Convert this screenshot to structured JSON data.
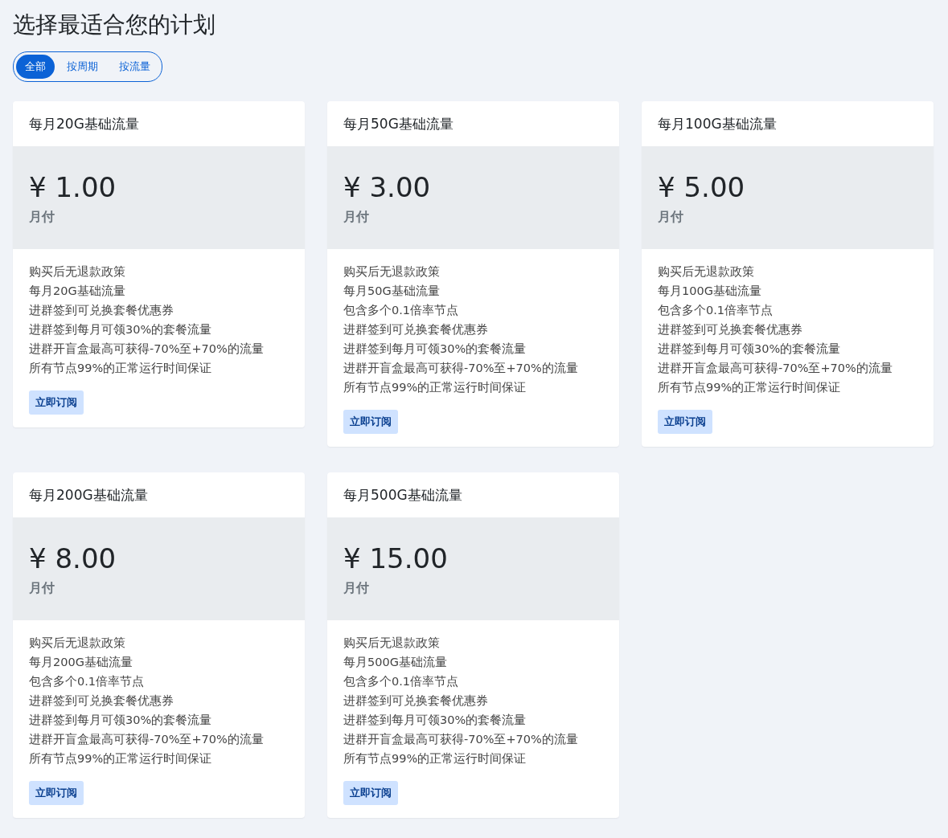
{
  "title": "选择最适合您的计划",
  "tabs": [
    {
      "label": "全部",
      "selected": true
    },
    {
      "label": "按周期",
      "selected": false
    },
    {
      "label": "按流量",
      "selected": false
    }
  ],
  "plans": [
    {
      "name": "每月20G基础流量",
      "price": "¥ 1.00",
      "period": "月付",
      "features": [
        "购买后无退款政策",
        "每月20G基础流量",
        "进群签到可兑换套餐优惠券",
        "进群签到每月可领30%的套餐流量",
        "进群开盲盒最高可获得-70%至+70%的流量",
        "所有节点99%的正常运行时间保证"
      ],
      "button": "立即订阅"
    },
    {
      "name": "每月50G基础流量",
      "price": "¥ 3.00",
      "period": "月付",
      "features": [
        "购买后无退款政策",
        "每月50G基础流量",
        "包含多个0.1倍率节点",
        "进群签到可兑换套餐优惠券",
        "进群签到每月可领30%的套餐流量",
        "进群开盲盒最高可获得-70%至+70%的流量",
        "所有节点99%的正常运行时间保证"
      ],
      "button": "立即订阅"
    },
    {
      "name": "每月100G基础流量",
      "price": "¥ 5.00",
      "period": "月付",
      "features": [
        "购买后无退款政策",
        "每月100G基础流量",
        "包含多个0.1倍率节点",
        "进群签到可兑换套餐优惠券",
        "进群签到每月可领30%的套餐流量",
        "进群开盲盒最高可获得-70%至+70%的流量",
        "所有节点99%的正常运行时间保证"
      ],
      "button": "立即订阅"
    },
    {
      "name": "每月200G基础流量",
      "price": "¥ 8.00",
      "period": "月付",
      "features": [
        "购买后无退款政策",
        "每月200G基础流量",
        "包含多个0.1倍率节点",
        "进群签到可兑换套餐优惠券",
        "进群签到每月可领30%的套餐流量",
        "进群开盲盒最高可获得-70%至+70%的流量",
        "所有节点99%的正常运行时间保证"
      ],
      "button": "立即订阅"
    },
    {
      "name": "每月500G基础流量",
      "price": "¥ 15.00",
      "period": "月付",
      "features": [
        "购买后无退款政策",
        "每月500G基础流量",
        "包含多个0.1倍率节点",
        "进群签到可兑换套餐优惠券",
        "进群签到每月可领30%的套餐流量",
        "进群开盲盒最高可获得-70%至+70%的流量",
        "所有节点99%的正常运行时间保证"
      ],
      "button": "立即订阅"
    }
  ]
}
